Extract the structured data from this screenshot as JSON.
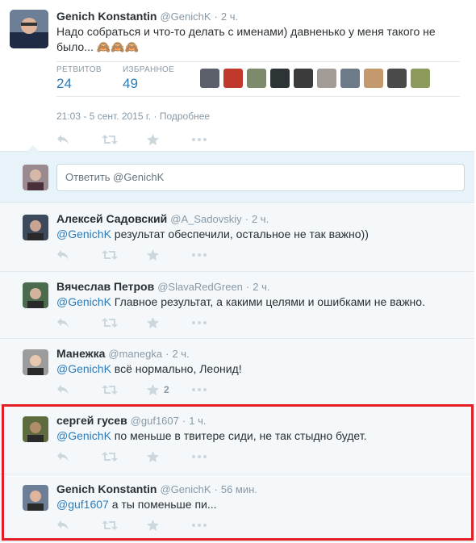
{
  "main_tweet": {
    "fullname": "Genich Konstantin",
    "username": "@GenichK",
    "time": "2 ч.",
    "text_line1": "Надо собраться и что-то делать с именами) давненько у меня такого не",
    "text_line2": "было... 🙈🙈🙈",
    "retweets_label": "РЕТВИТОВ",
    "retweets_count": "24",
    "favorites_label": "ИЗБРАННОЕ",
    "favorites_count": "49",
    "timestamp": "21:03 - 5 сент. 2015 г.",
    "details_link": "Подробнее"
  },
  "reply_box": {
    "text": "Ответить @GenichK"
  },
  "replies": [
    {
      "fullname": "Алексей Садовский",
      "username": "@A_Sadovskiy",
      "time": "2 ч.",
      "mention": "@GenichK",
      "text": " результат обеспечили, остальное не так важно))",
      "fav_count": ""
    },
    {
      "fullname": "Вячеслав Петров",
      "username": "@SlavaRedGreen",
      "time": "2 ч.",
      "mention": "@GenichK",
      "text": " Главное результат, а какими целями и ошибками не важно.",
      "fav_count": ""
    },
    {
      "fullname": "Манежка",
      "username": "@manegka",
      "time": "2 ч.",
      "mention": "@GenichK",
      "text": " всё нормально, Леонид!",
      "fav_count": "2"
    },
    {
      "fullname": "сергей гусев",
      "username": "@guf1607",
      "time": "1 ч.",
      "mention": "@GenichK",
      "text": " по меньше в твитере сиди, не так стыдно будет.",
      "fav_count": ""
    },
    {
      "fullname": "Genich Konstantin",
      "username": "@GenichK",
      "time": "56 мин.",
      "mention": "@guf1607",
      "text": " а ты поменьше пи...",
      "fav_count": ""
    }
  ],
  "icons": {
    "reply": "reply-arrow-icon",
    "retweet": "retweet-icon",
    "favorite": "star-icon",
    "more": "more-dots-icon"
  },
  "colors": {
    "link": "#2b7bb9",
    "muted": "#8899a6",
    "highlight_border": "#e31e24",
    "reply_box_bg": "#e8f2f9"
  }
}
